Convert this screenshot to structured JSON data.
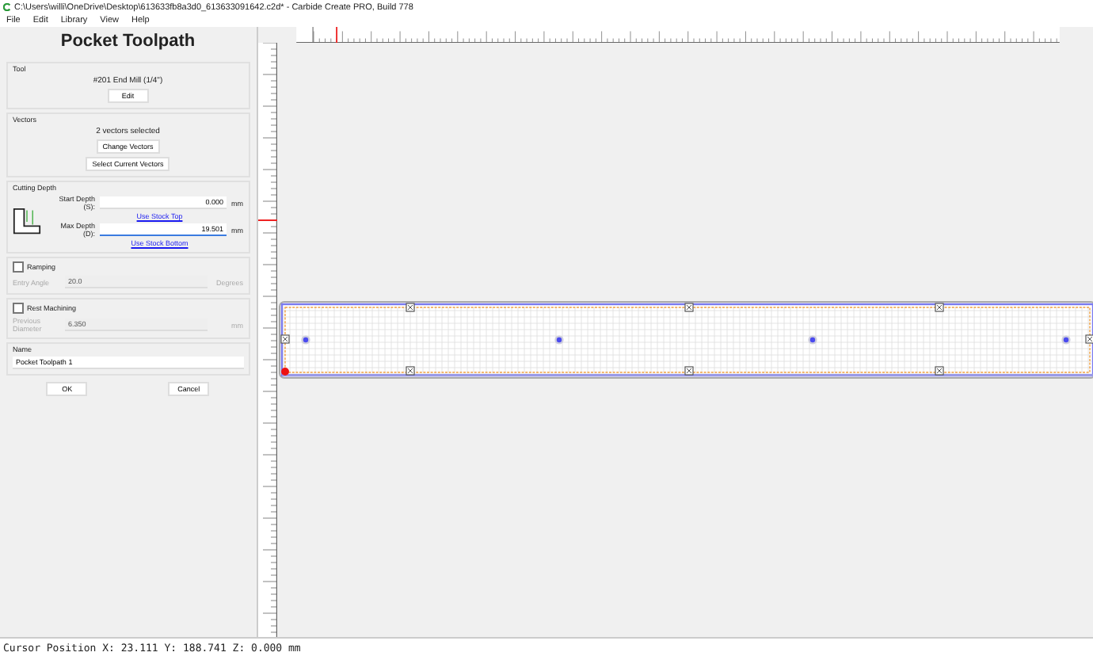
{
  "window": {
    "title": "C:\\Users\\willi\\OneDrive\\Desktop\\613633fb8a3d0_613633091642.c2d* - Carbide Create PRO, Build 778"
  },
  "menu": [
    "File",
    "Edit",
    "Library",
    "View",
    "Help"
  ],
  "panel": {
    "title": "Pocket Toolpath",
    "tool": {
      "label": "Tool",
      "name": "#201 End Mill (1/4\")",
      "button": "Edit"
    },
    "vectors": {
      "label": "Vectors",
      "status": "2 vectors selected",
      "buttons": [
        "Change Vectors",
        "Select Current Vectors"
      ]
    },
    "cutting_depth": {
      "label": "Cutting Depth",
      "start": {
        "label": "Start Depth (S):",
        "value": "0.000",
        "unit": "mm",
        "link": "Use Stock Top"
      },
      "max": {
        "label": "Max Depth (D):",
        "value": "19.501",
        "unit": "mm",
        "link": "Use Stock Bottom"
      }
    },
    "ramping": {
      "label": "Ramping",
      "checked": false,
      "field": {
        "label": "Entry Angle",
        "value": "20.0",
        "unit": "Degrees"
      }
    },
    "rest_machining": {
      "label": "Rest Machining",
      "checked": false,
      "field": {
        "label": "Previous Diameter",
        "value": "6.350",
        "unit": "mm"
      }
    },
    "name": {
      "label": "Name",
      "value": "Pocket Toolpath 1"
    },
    "buttons": [
      "OK",
      "Cancel"
    ]
  },
  "status_bar": "Cursor Position X: 23.111 Y: 188.741 Z: 0.000 mm"
}
